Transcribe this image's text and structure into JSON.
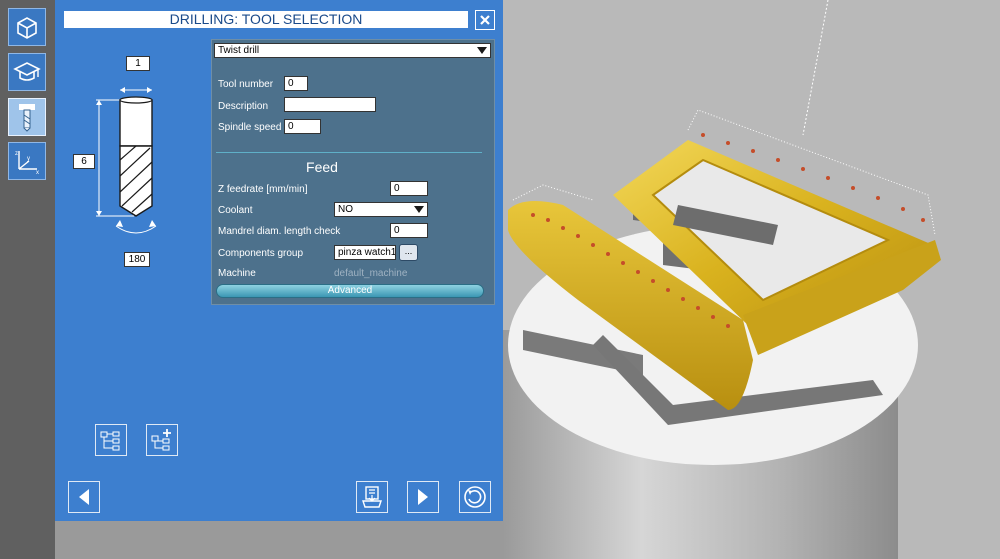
{
  "window": {
    "title": "DRILLING: TOOL SELECTION"
  },
  "tool_diagram": {
    "length": "1",
    "diameter": "6",
    "angle": "180"
  },
  "tool_type": {
    "selected": "Twist drill"
  },
  "fields": {
    "tool_number": {
      "label": "Tool number",
      "value": "0"
    },
    "description": {
      "label": "Description",
      "value": ""
    },
    "spindle_speed": {
      "label": "Spindle speed",
      "value": "0"
    }
  },
  "feed": {
    "heading": "Feed",
    "z_feedrate": {
      "label": "Z feedrate [mm/min]",
      "value": "0"
    },
    "coolant": {
      "label": "Coolant",
      "value": "NO"
    },
    "mandrel": {
      "label": "Mandrel diam. length check",
      "value": "0"
    },
    "components_group": {
      "label": "Components group",
      "value": "pinza watch1",
      "browse": "..."
    },
    "machine": {
      "label": "Machine",
      "value": "default_machine"
    },
    "advanced_label": "Advanced"
  },
  "icons": [
    "cube-icon",
    "graduation-cap-icon",
    "drill-tool-icon",
    "axis-icon",
    "tree-collapse-icon",
    "tree-add-icon",
    "back-arrow-icon",
    "save-icon",
    "forward-arrow-icon",
    "refresh-icon"
  ],
  "colors": {
    "panel": "#3d7fcf",
    "settings_bg": "#4d718c",
    "accent": "#5fb0c8",
    "part": "#e8c63a"
  }
}
